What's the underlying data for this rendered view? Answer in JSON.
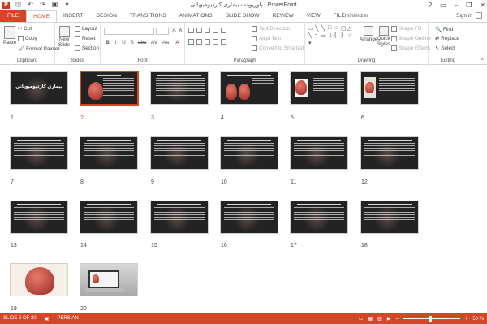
{
  "window": {
    "title": "پاورپوینت بیماری کاردیومیوپاتی - PowerPoint",
    "app_icon": "P",
    "controls": [
      "?",
      "▭",
      "–",
      "❐",
      "✕"
    ]
  },
  "qat": [
    {
      "icon": "save-icon",
      "glyph": "🖫"
    },
    {
      "icon": "undo-icon",
      "glyph": "↶"
    },
    {
      "icon": "redo-icon",
      "glyph": "↷"
    },
    {
      "icon": "start-slideshow-icon",
      "glyph": "▣"
    },
    {
      "icon": "customize-qat-icon",
      "glyph": "▾"
    }
  ],
  "tabs": [
    "FILE",
    "HOME",
    "INSERT",
    "DESIGN",
    "TRANSITIONS",
    "ANIMATIONS",
    "SLIDE SHOW",
    "REVIEW",
    "VIEW",
    "FILEminimizer"
  ],
  "active_tab": "HOME",
  "signin": "Sign in",
  "ribbon": {
    "clipboard": {
      "label": "Clipboard",
      "paste": "Paste",
      "cut": "Cut",
      "copy": "Copy",
      "format_painter": "Format Painter"
    },
    "slides": {
      "label": "Slides",
      "new_slide": "New",
      "new_slide2": "Slide",
      "layout": "Layout",
      "reset": "Reset",
      "section": "Section"
    },
    "font": {
      "label": "Font",
      "bold": "B",
      "italic": "I",
      "underline": "U",
      "shadow": "S",
      "strike": "abc",
      "spacing": "AV",
      "case": "Aa",
      "color": "A"
    },
    "paragraph": {
      "label": "Paragraph",
      "text_direction": "Text Direction",
      "align_text": "Align Text",
      "convert_smartart": "Convert to SmartArt"
    },
    "drawing": {
      "label": "Drawing",
      "arrange": "Arrange",
      "quick_styles": "Quick",
      "quick_styles2": "Styles",
      "shape_fill": "Shape Fill",
      "shape_outline": "Shape Outline",
      "shape_effects": "Shape Effects"
    },
    "editing": {
      "label": "Editing",
      "find": "Find",
      "replace": "Replace",
      "select": "Select"
    }
  },
  "slides": [
    {
      "num": "1",
      "type": "title",
      "title_text": "بیماری کاردیومیوپاتی"
    },
    {
      "num": "2",
      "type": "heart-text",
      "selected": true
    },
    {
      "num": "3",
      "type": "text"
    },
    {
      "num": "4",
      "type": "two-hearts"
    },
    {
      "num": "5",
      "type": "heart-light"
    },
    {
      "num": "6",
      "type": "heart-light2"
    },
    {
      "num": "7",
      "type": "text"
    },
    {
      "num": "8",
      "type": "text"
    },
    {
      "num": "9",
      "type": "text"
    },
    {
      "num": "10",
      "type": "text"
    },
    {
      "num": "11",
      "type": "text"
    },
    {
      "num": "12",
      "type": "text"
    },
    {
      "num": "13",
      "type": "text"
    },
    {
      "num": "14",
      "type": "text"
    },
    {
      "num": "15",
      "type": "text"
    },
    {
      "num": "16",
      "type": "text"
    },
    {
      "num": "17",
      "type": "text"
    },
    {
      "num": "18",
      "type": "text"
    },
    {
      "num": "19",
      "type": "heart-photo"
    },
    {
      "num": "20",
      "type": "laptop"
    }
  ],
  "status": {
    "slide_info": "SLIDE 2 OF 20",
    "language": "PERSIAN",
    "zoom": "50 %",
    "zoom_minus": "–",
    "zoom_plus": "+"
  }
}
